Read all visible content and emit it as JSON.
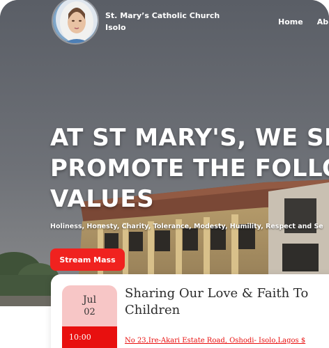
{
  "header": {
    "site_title": "St. Mary’s Catholic Church Isolo",
    "nav": [
      {
        "label": "Home"
      },
      {
        "label": "Ab"
      }
    ]
  },
  "hero": {
    "heading": "AT ST MARY'S, WE SE\nPROMOTE THE FOLLO\nVALUES",
    "values_line": "Holiness, Honesty, Charity, Tolerance, Modesty, Humility, Respect and Se",
    "stream_button_label": "Stream Mass"
  },
  "event": {
    "month": "Jul",
    "day": "02",
    "time": "10:00",
    "title": "Sharing Our Love & Faith To Children",
    "address": "No 23,Ire-Akari Estate Road, Oshodi- Isolo,Lagos $"
  },
  "colors": {
    "accent_red": "#f0221f",
    "date_pink": "#f7c6c6",
    "date_red": "#e8100f"
  }
}
